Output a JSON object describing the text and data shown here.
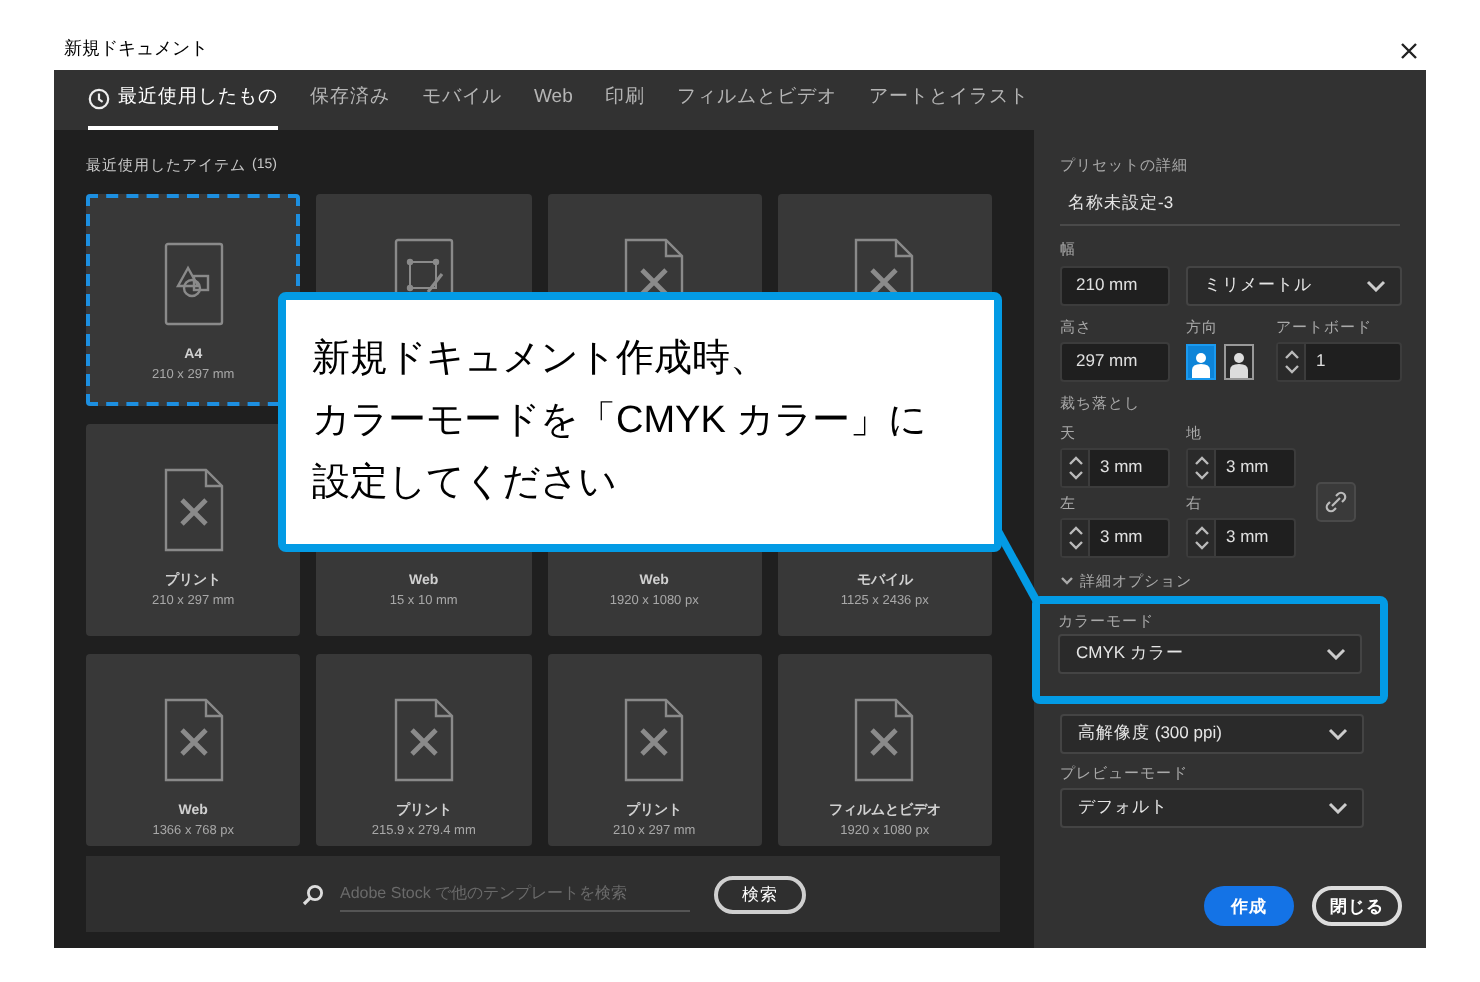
{
  "window": {
    "title": "新規ドキュメント"
  },
  "tabs": [
    {
      "label": "最近使用したもの",
      "kind": "icon",
      "selected": true
    },
    {
      "label": "保存済み",
      "kind": "text",
      "selected": false
    },
    {
      "label": "モバイル",
      "kind": "text",
      "selected": false
    },
    {
      "label": "Web",
      "kind": "text",
      "selected": false
    },
    {
      "label": "印刷",
      "kind": "text",
      "selected": false
    },
    {
      "label": "フィルムとビデオ",
      "kind": "text",
      "selected": false
    },
    {
      "label": "アートとイラスト",
      "kind": "text",
      "selected": false
    }
  ],
  "recent": {
    "heading": "最近使用したアイテム",
    "count": "(15)",
    "items": [
      {
        "kind": "shapes",
        "name": "A4",
        "size": "210 x 297 mm",
        "selected": true
      },
      {
        "kind": "artboard",
        "selected": false
      },
      {
        "kind": "doc",
        "selected": false
      },
      {
        "kind": "doc",
        "selected": false
      },
      {
        "kind": "doc",
        "name": "プリント",
        "size": "210 x 297 mm",
        "selected": false
      },
      {
        "kind": "none",
        "name": "Web",
        "size": "15 x 10 mm",
        "selected": false
      },
      {
        "kind": "none",
        "name": "Web",
        "size": "1920 x 1080 px",
        "selected": false
      },
      {
        "kind": "none",
        "name": "モバイル",
        "size": "1125 x 2436 px",
        "selected": false
      },
      {
        "kind": "doc",
        "name": "Web",
        "size": "1366 x 768 px",
        "selected": false
      },
      {
        "kind": "doc",
        "name": "プリント",
        "size": "215.9 x 279.4 mm",
        "selected": false
      },
      {
        "kind": "doc",
        "name": "プリント",
        "size": "210 x 297 mm",
        "selected": false
      },
      {
        "kind": "doc",
        "name": "フィルムとビデオ",
        "size": "1920 x 1080 px",
        "selected": false
      }
    ]
  },
  "search": {
    "placeholder": "Adobe Stock で他のテンプレートを検索",
    "button": "検索"
  },
  "preset": {
    "heading": "プリセットの詳細",
    "name": "名称未設定-3",
    "width_label": "幅",
    "width": "210 mm",
    "unit": "ミリメートル",
    "height_label": "高さ",
    "height": "297 mm",
    "orientation_label": "方向",
    "orientations": [
      {
        "selected": true
      },
      {
        "selected": false
      }
    ],
    "artboards_label": "アートボード",
    "artboards": "1",
    "bleed_label": "裁ち落とし",
    "bleeds": [
      {
        "label": "天",
        "value": "3 mm"
      },
      {
        "label": "地",
        "value": "3 mm"
      },
      {
        "label": "左",
        "value": "3 mm"
      },
      {
        "label": "右",
        "value": "3 mm"
      }
    ],
    "advanced": "詳細オプション",
    "color_mode_label": "カラーモード",
    "color_mode": "CMYK カラー",
    "raster": "高解像度 (300 ppi)",
    "preview_label": "プレビューモード",
    "preview": "デフォルト"
  },
  "buttons": {
    "create": "作成",
    "close": "閉じる"
  },
  "callout": {
    "lines": [
      "新規ドキュメント作成時、",
      "カラーモードを「CMYK カラー」に",
      "設定してください"
    ]
  }
}
